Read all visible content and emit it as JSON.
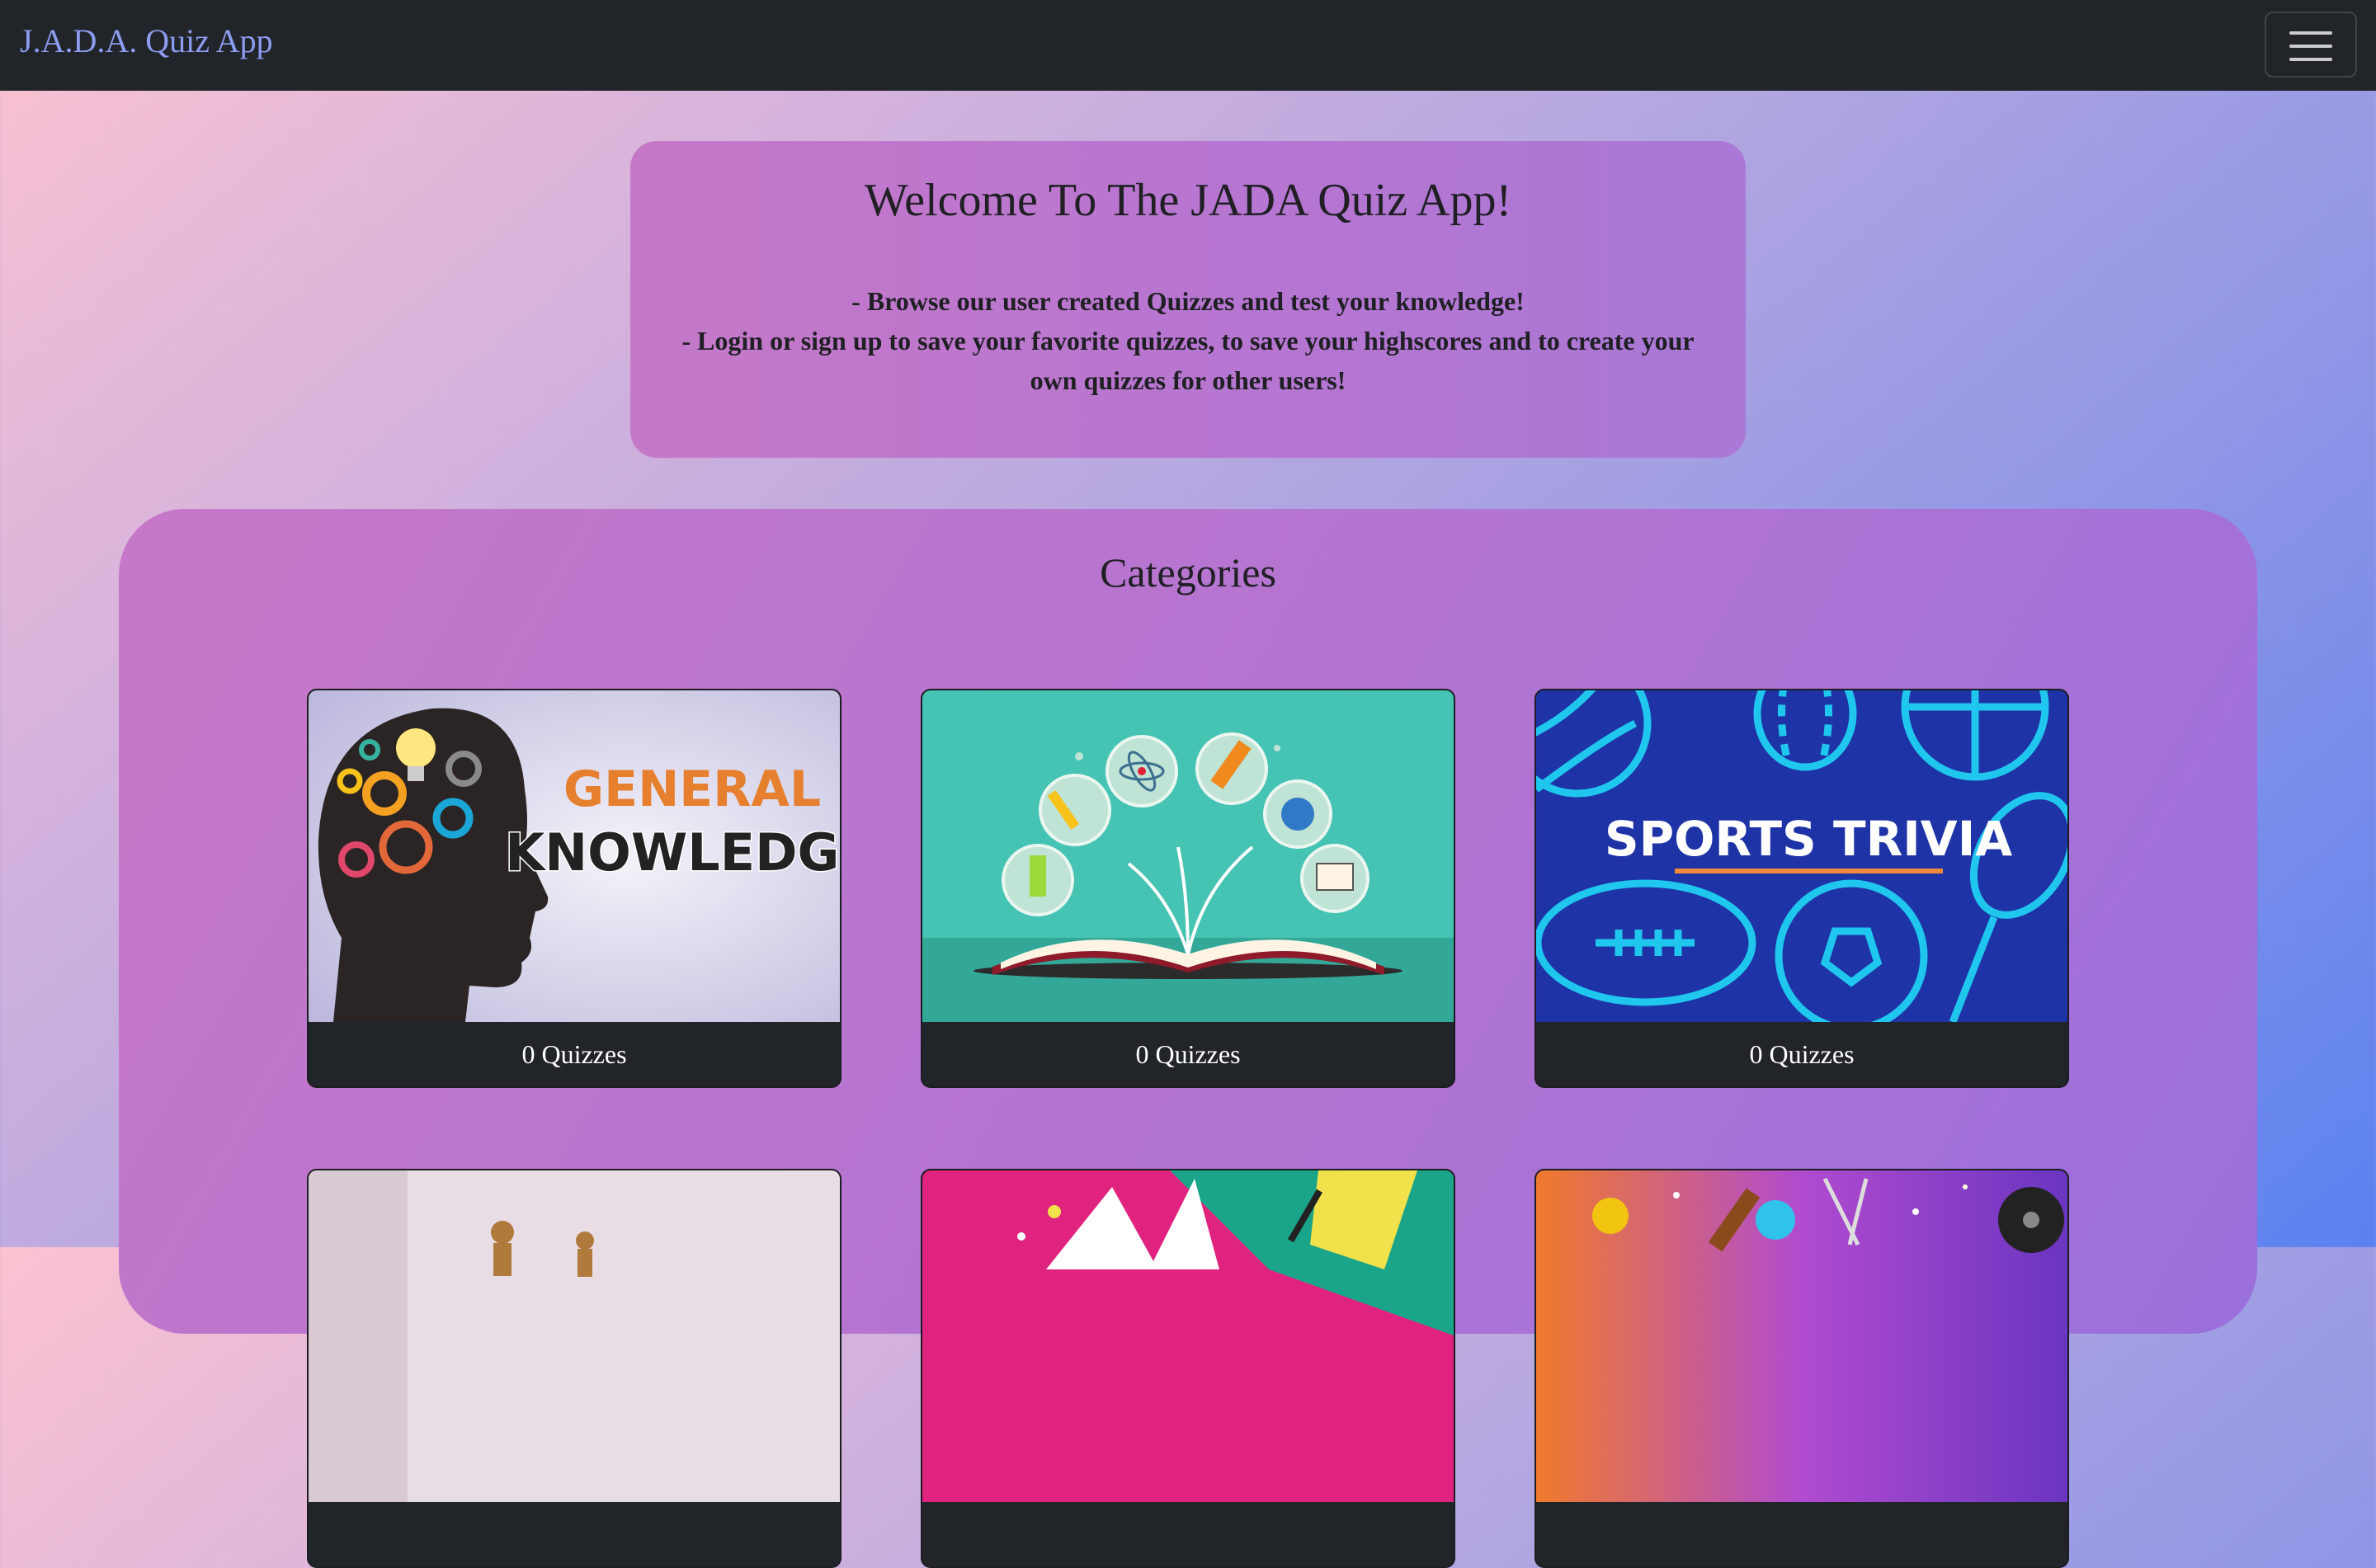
{
  "navbar": {
    "brand": "J.A.D.A. Quiz App",
    "menu_icon": "hamburger-menu-icon"
  },
  "welcome": {
    "title": "Welcome To The JADA Quiz App!",
    "line1": "- Browse our user created Quizzes and test your knowledge!",
    "line2": "- Login or sign up to save your favorite quizzes, to save your highscores and to create your own quizzes for other users!"
  },
  "categories": {
    "heading": "Categories",
    "cards": [
      {
        "image_text_1": "GENERAL",
        "image_text_2": "KNOWLEDGE",
        "count_label": "0 Quizzes"
      },
      {
        "count_label": "0 Quizzes"
      },
      {
        "image_text": "SPORTS TRIVIA",
        "count_label": "0 Quizzes"
      },
      {
        "count_label": ""
      },
      {
        "count_label": ""
      },
      {
        "count_label": ""
      }
    ]
  },
  "colors": {
    "navbar_bg": "#212529",
    "brand": "#8c9cf0",
    "panel": "#c078cc",
    "card_footer": "#212529"
  }
}
